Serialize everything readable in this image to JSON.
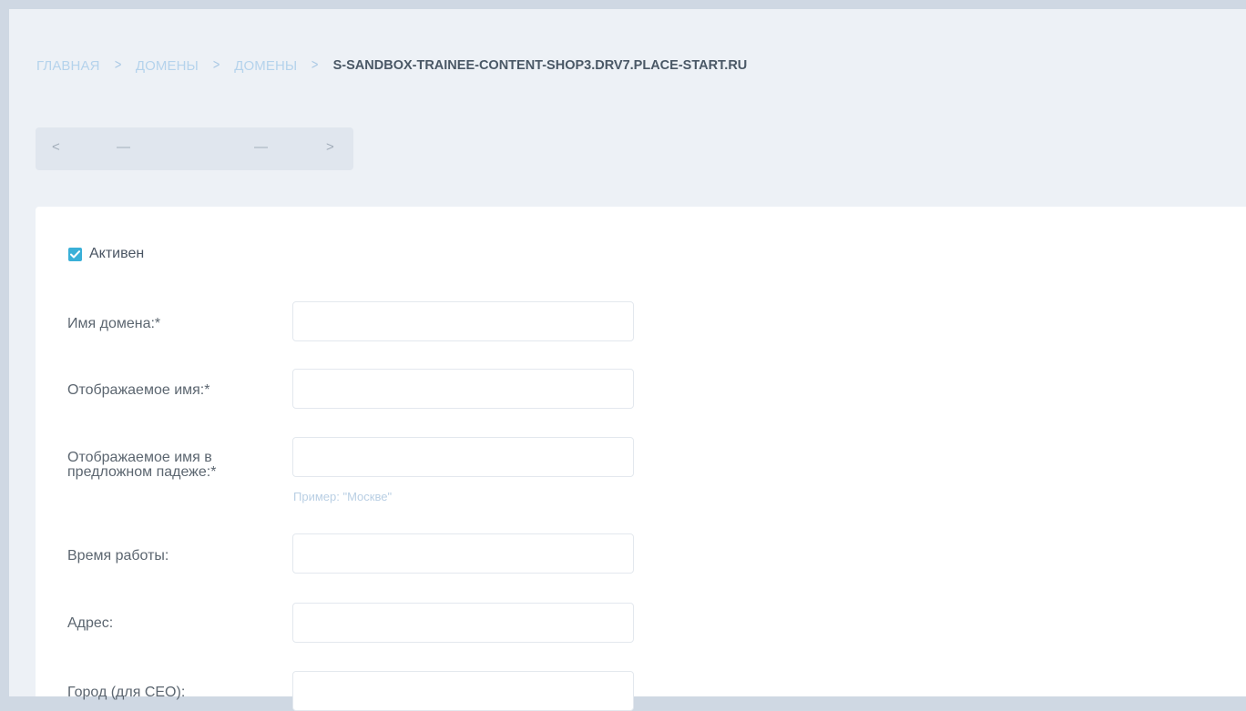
{
  "breadcrumb": {
    "items": [
      "Главная",
      "Домены",
      "Домены"
    ],
    "separator": ">",
    "current": "S-SANDBOX-TRAINEE-CONTENT-SHOP3.DRV7.PLACE-START.RU"
  },
  "pager": {
    "prev": "<",
    "value_left": "—",
    "value_right": "—",
    "next": ">"
  },
  "form": {
    "active": {
      "label": "Активен",
      "checked": true
    },
    "domain_name": {
      "label": "Имя домена:*",
      "value": ""
    },
    "display_name": {
      "label": "Отображаемое имя:*",
      "value": ""
    },
    "display_name_prepositional": {
      "label": "Отображаемое имя в предложном падеже:*",
      "value": "",
      "hint": "Пример: \"Москве\""
    },
    "working_hours": {
      "label": "Время работы:",
      "value": ""
    },
    "address": {
      "label": "Адрес:",
      "value": ""
    },
    "city_seo": {
      "label": "Город (для СЕО):",
      "value": ""
    }
  },
  "colors": {
    "accent": "#3ab0d8",
    "breadcrumb_link": "#b5d3ec",
    "page_background": "#edf1f6"
  }
}
